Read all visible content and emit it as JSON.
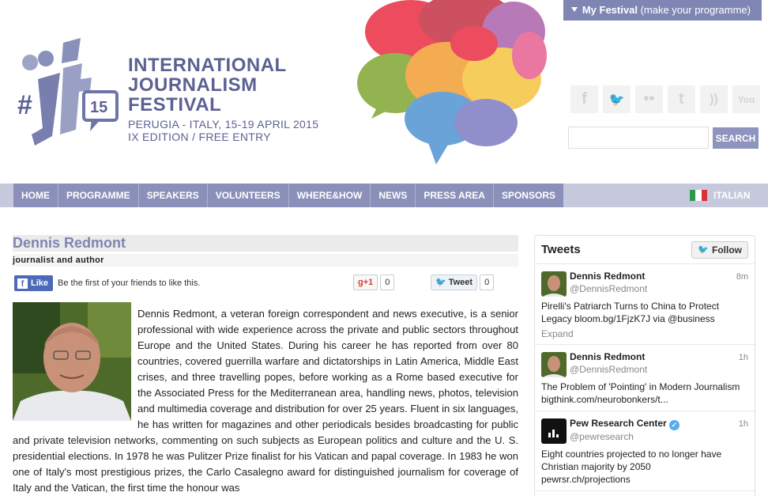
{
  "top_bar": {
    "my_festival": "My Festival",
    "my_festival_sub": "(make your programme)"
  },
  "logo": {
    "hash": "#",
    "letters": "jf",
    "badge": "15"
  },
  "title": {
    "line1": "INTERNATIONAL",
    "line2": "JOURNALISM",
    "line3": "FESTIVAL",
    "line4": "PERUGIA - ITALY, 15-19 APRIL 2015",
    "line5": "IX EDITION / FREE ENTRY"
  },
  "social": [
    {
      "icon": "facebook-icon",
      "glyph": "f"
    },
    {
      "icon": "twitter-icon",
      "glyph": "🐦"
    },
    {
      "icon": "flickr-icon",
      "glyph": "••"
    },
    {
      "icon": "tumblr-icon",
      "glyph": "t"
    },
    {
      "icon": "rss-icon",
      "glyph": "))"
    },
    {
      "icon": "youtube-icon",
      "glyph": "You"
    }
  ],
  "search": {
    "value": "",
    "button": "SEARCH"
  },
  "nav": {
    "items": [
      "HOME",
      "PROGRAMME",
      "SPEAKERS",
      "VOLUNTEERS",
      "WHERE&HOW",
      "NEWS",
      "PRESS AREA",
      "SPONSORS"
    ],
    "language": "ITALIAN"
  },
  "speaker": {
    "name": "Dennis Redmont",
    "role": "journalist and author",
    "bio": "Dennis Redmont, a veteran foreign correspondent and news executive, is a senior professional with wide experience across the private and public sectors throughout Europe and the United States. During his career he has reported from over 80 countries, covered guerrilla warfare and dictatorships in Latin America, Middle East crises, and three travelling popes, before working as a Rome based executive for the Associated Press for the Mediterranean area, handling news, photos, television and multimedia coverage and distribution for over 25 years. Fluent in six languages, he has written for magazines and other periodicals besides broadcasting for public and private television networks, commenting on such subjects as European politics and culture and the U. S. presidential elections. In 1978 he was Pulitzer Prize finalist for his Vatican and papal coverage. In 1983 he won one of Italy's most prestigious prizes, the Carlo Casalegno award for distinguished journalism for coverage of Italy and the Vatican, the first time the honour was"
  },
  "share": {
    "fb_like": "Like",
    "fb_text": "Be the first of your friends to like this.",
    "gplus": "+1",
    "gplus_count": "0",
    "tweet": "Tweet",
    "tweet_count": "0"
  },
  "tweets_widget": {
    "title": "Tweets",
    "follow": "Follow",
    "tweets": [
      {
        "name": "Dennis Redmont",
        "handle": "@DennisRedmont",
        "time": "8m",
        "text": "Pirelli's Patriarch Turns to China to Protect Legacy bloom.bg/1FjzK7J via @business",
        "expand": "Expand"
      },
      {
        "name": "Dennis Redmont",
        "handle": "@DennisRedmont",
        "time": "1h",
        "text": "The Problem of 'Pointing' in Modern Journalism bigthink.com/neurobonkers/t...",
        "expand": ""
      },
      {
        "name": "Pew Research Center",
        "handle": "@pewresearch",
        "time": "1h",
        "text": "Eight countries projected to no longer have Christian majority by 2050",
        "link": "pewrsr.ch/projections"
      }
    ]
  },
  "colors": {
    "accent": "#8a90b9",
    "title": "#5c6193",
    "name": "#7f85b3"
  }
}
